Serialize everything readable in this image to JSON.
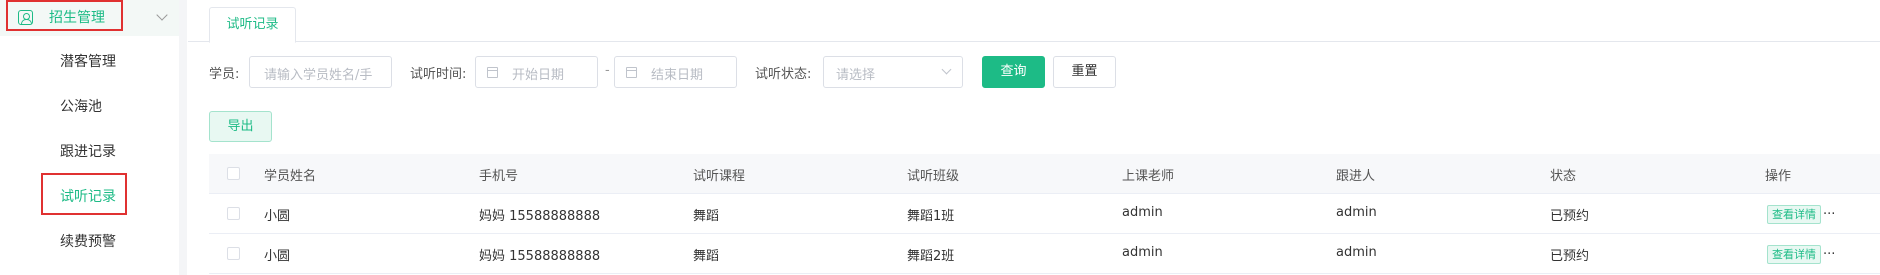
{
  "sidebar": {
    "group_label": "招生管理",
    "items": [
      {
        "label": "潜客管理"
      },
      {
        "label": "公海池"
      },
      {
        "label": "跟进记录"
      },
      {
        "label": "试听记录"
      },
      {
        "label": "续费预警"
      }
    ]
  },
  "tabs": [
    {
      "label": "试听记录"
    }
  ],
  "filters": {
    "student_label": "学员:",
    "student_placeholder": "请输入学员姓名/手",
    "time_label": "试听时间:",
    "start_placeholder": "开始日期",
    "range_sep": "-",
    "end_placeholder": "结束日期",
    "status_label": "试听状态:",
    "status_placeholder": "请选择",
    "search_button": "查询",
    "reset_button": "重置"
  },
  "export_button": "导出",
  "table": {
    "columns": [
      "学员姓名",
      "手机号",
      "试听课程",
      "试听班级",
      "上课老师",
      "跟进人",
      "状态",
      "操作"
    ],
    "rows": [
      {
        "name": "小圆",
        "phone": "妈妈 15588888888",
        "course": "舞蹈",
        "class": "舞蹈1班",
        "teacher": "admin",
        "follower": "admin",
        "status": "已预约",
        "action": "查看详情",
        "more": "..."
      },
      {
        "name": "小圆",
        "phone": "妈妈 15588888888",
        "course": "舞蹈",
        "class": "舞蹈2班",
        "teacher": "admin",
        "follower": "admin",
        "status": "已预约",
        "action": "查看详情",
        "more": "..."
      }
    ]
  },
  "colors": {
    "accent": "#1dbb86",
    "highlight": "#e03131"
  }
}
